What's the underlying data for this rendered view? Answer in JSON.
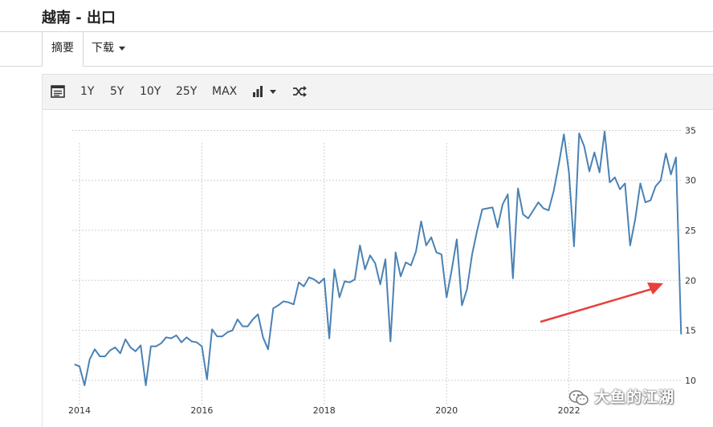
{
  "header": {
    "title": "越南 - 出口"
  },
  "tabs": {
    "summary": "摘要",
    "download": "下载"
  },
  "toolbar": {
    "ranges": [
      "1Y",
      "5Y",
      "10Y",
      "25Y",
      "MAX"
    ],
    "icons": [
      "list-icon",
      "bar-chart-icon",
      "shuffle-icon"
    ]
  },
  "watermark": {
    "text": "大鱼的江湖"
  },
  "colors": {
    "line": "#4a82b4",
    "arrow": "#e8403a"
  },
  "chart_data": {
    "type": "line",
    "title": "",
    "xlabel": "",
    "ylabel": "",
    "x_ticks": [
      "2014",
      "2016",
      "2018",
      "2020",
      "2022"
    ],
    "y_ticks": [
      10,
      15,
      20,
      25,
      30,
      35
    ],
    "ylim": [
      7.5,
      36
    ],
    "grid": true,
    "annotation": "red arrow pointing to last drop",
    "series": [
      {
        "start": "2013-12",
        "frequency": "monthly",
        "values": [
          11.6,
          11.4,
          9.5,
          12.1,
          13.1,
          12.4,
          12.4,
          13.0,
          13.3,
          12.7,
          14.1,
          13.3,
          12.9,
          13.5,
          9.5,
          13.4,
          13.4,
          13.7,
          14.3,
          14.2,
          14.5,
          13.8,
          14.3,
          13.9,
          13.8,
          13.4,
          10.1,
          15.1,
          14.4,
          14.4,
          14.8,
          15.0,
          16.1,
          15.4,
          15.4,
          16.1,
          16.6,
          14.3,
          13.1,
          17.2,
          17.5,
          17.9,
          17.8,
          17.6,
          19.8,
          19.4,
          20.3,
          20.1,
          19.7,
          20.2,
          14.2,
          21.1,
          18.3,
          19.9,
          19.8,
          20.1,
          23.5,
          21.1,
          22.5,
          21.7,
          19.6,
          22.1,
          13.9,
          22.8,
          20.4,
          21.8,
          21.5,
          22.9,
          25.9,
          23.5,
          24.3,
          22.8,
          22.6,
          18.3,
          21.0,
          24.1,
          17.5,
          19.1,
          22.6,
          25.0,
          27.1,
          27.2,
          27.3,
          25.3,
          27.6,
          28.6,
          20.2,
          29.2,
          26.6,
          26.2,
          27.0,
          27.8,
          27.2,
          27.0,
          28.9,
          31.6,
          34.6,
          30.8,
          23.4,
          34.7,
          33.4,
          30.9,
          32.8,
          30.8,
          34.9,
          29.8,
          30.3,
          29.1,
          29.7,
          23.5,
          26.1,
          29.7,
          27.8,
          28.0,
          29.4,
          30.0,
          32.7,
          30.6,
          32.3,
          14.6
        ]
      }
    ]
  }
}
